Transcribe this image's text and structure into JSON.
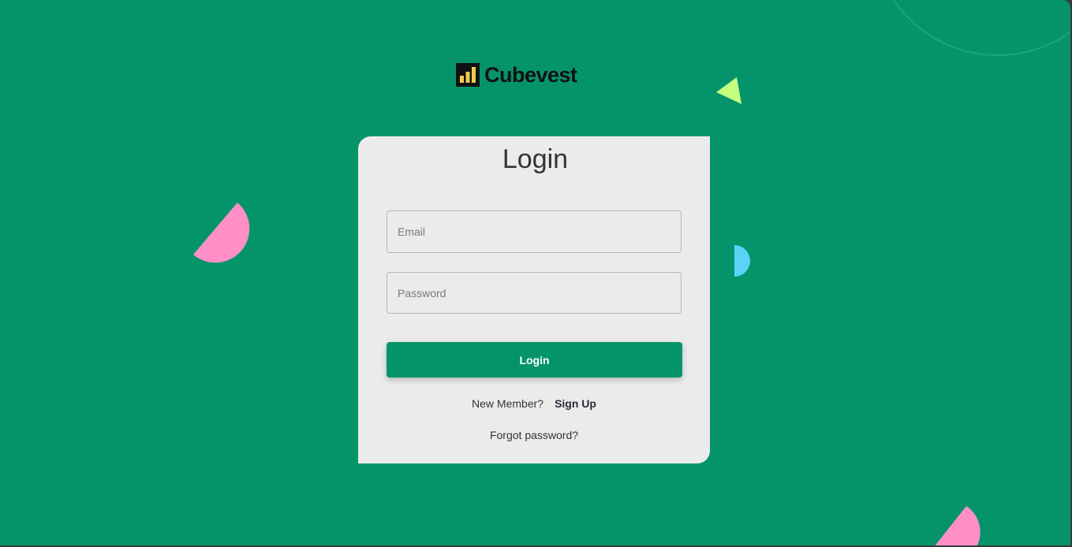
{
  "brand": {
    "name": "Cubevest",
    "logo_icon": "bar-chart-icon",
    "logo_bg": "#111111",
    "logo_bar_color": "#f2c94c"
  },
  "colors": {
    "background": "#05946a",
    "card": "#ebebeb",
    "accent": "#05946a",
    "deco_pink": "#ff8fc6",
    "deco_blue": "#5ad3f7",
    "deco_green": "#c4ff7f"
  },
  "login": {
    "title": "Login",
    "email_placeholder": "Email",
    "email_value": "",
    "password_placeholder": "Password",
    "password_value": "",
    "submit_label": "Login",
    "new_member_text": "New Member?",
    "signup_label": "Sign Up",
    "forgot_label": "Forgot password?"
  }
}
